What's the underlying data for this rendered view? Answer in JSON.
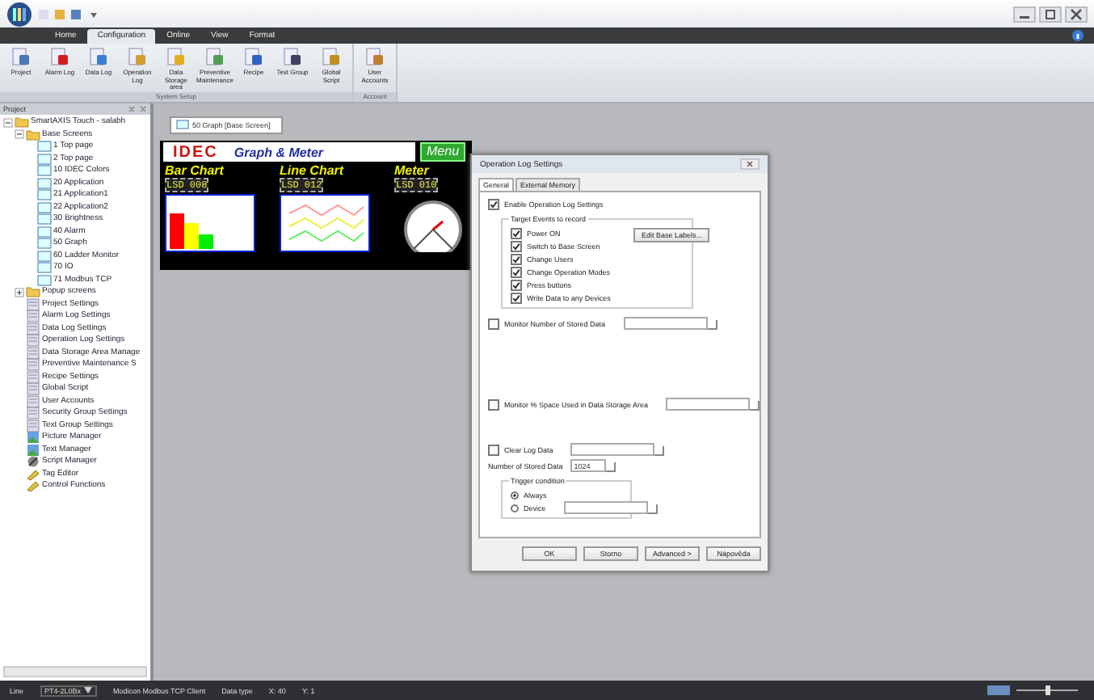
{
  "ribbon": {
    "tabs": [
      {
        "label": "Home",
        "selected": false
      },
      {
        "label": "Configuration",
        "selected": true
      },
      {
        "label": "Online",
        "selected": false
      },
      {
        "label": "View",
        "selected": false
      },
      {
        "label": "Format",
        "selected": false
      }
    ],
    "groups": [
      {
        "label": "System Setup",
        "buttons": [
          {
            "label": "Project"
          },
          {
            "label": "Alarm Log"
          },
          {
            "label": "Data Log"
          },
          {
            "label": "Operation Log"
          },
          {
            "label": "Data Storage area"
          },
          {
            "label": "Preventive Maintenance"
          },
          {
            "label": "Recipe"
          },
          {
            "label": "Text Group"
          },
          {
            "label": "Global Script"
          }
        ]
      },
      {
        "label": "Account",
        "buttons": [
          {
            "label": "User Accounts"
          }
        ]
      }
    ]
  },
  "project_panel": {
    "title": "Project",
    "tree": [
      {
        "label": "SmartAXIS Touch - salabh",
        "kind": "folder",
        "expanded": true,
        "children": [
          {
            "label": "Base Screens",
            "kind": "folder",
            "expanded": true,
            "children": [
              {
                "label": "1 Top page",
                "kind": "screen"
              },
              {
                "label": "2 Top page",
                "kind": "screen"
              },
              {
                "label": "10 IDEC Colors",
                "kind": "screen"
              },
              {
                "label": "20 Application",
                "kind": "screen"
              },
              {
                "label": "21 Application1",
                "kind": "screen"
              },
              {
                "label": "22 Application2",
                "kind": "screen"
              },
              {
                "label": "30 Brightness",
                "kind": "screen"
              },
              {
                "label": "40 Alarm",
                "kind": "screen"
              },
              {
                "label": "50 Graph",
                "kind": "screen"
              },
              {
                "label": "60 Ladder Monitor",
                "kind": "screen"
              },
              {
                "label": "70 IO",
                "kind": "screen"
              },
              {
                "label": "71 Modbus TCP",
                "kind": "screen"
              }
            ]
          },
          {
            "label": "Popup screens",
            "kind": "folder",
            "expanded": false
          },
          {
            "label": "Project Settings",
            "kind": "settings"
          },
          {
            "label": "Alarm Log Settings",
            "kind": "settings"
          },
          {
            "label": "Data Log Settings",
            "kind": "settings"
          },
          {
            "label": "Operation Log Settings",
            "kind": "settings"
          },
          {
            "label": "Data Storage Area Manage",
            "kind": "settings"
          },
          {
            "label": "Preventive Maintenance S",
            "kind": "settings"
          },
          {
            "label": "Recipe Settings",
            "kind": "settings"
          },
          {
            "label": "Global Script",
            "kind": "settings"
          },
          {
            "label": "User Accounts",
            "kind": "settings"
          },
          {
            "label": "Security Group Settings",
            "kind": "settings"
          },
          {
            "label": "Text Group Settings",
            "kind": "settings"
          },
          {
            "label": "Picture Manager",
            "kind": "picture"
          },
          {
            "label": "Text Manager",
            "kind": "picture"
          },
          {
            "label": "Script Manager",
            "kind": "script"
          },
          {
            "label": "Tag Editor",
            "kind": "tag"
          },
          {
            "label": "Control Functions",
            "kind": "tag"
          }
        ]
      }
    ]
  },
  "editor_tab": {
    "label": "50 Graph [Base Screen]"
  },
  "screen": {
    "logo": "IDEC",
    "title": "Graph & Meter",
    "menu_button": "Menu",
    "sections": [
      {
        "title": "Bar Chart",
        "kind": "bar",
        "lsd": "LSD 008"
      },
      {
        "title": "Line Chart",
        "kind": "line",
        "lsd": "LSD 012"
      },
      {
        "title": "Meter",
        "kind": "meter",
        "lsd": "LSD 010"
      }
    ]
  },
  "dialog": {
    "title": "Operation Log Settings",
    "tabs": [
      {
        "label": "General",
        "selected": true
      },
      {
        "label": "External Memory",
        "selected": false
      }
    ],
    "enable": {
      "label": "Enable Operation Log Settings",
      "checked": true
    },
    "events": {
      "title": "Target Events to record",
      "button": "Edit Base Labels...",
      "items": [
        {
          "label": "Power ON",
          "checked": true
        },
        {
          "label": "Switch to Base Screen",
          "checked": true
        },
        {
          "label": "Change Users",
          "checked": true
        },
        {
          "label": "Change Operation Modes",
          "checked": true
        },
        {
          "label": "Press buttons",
          "checked": true
        },
        {
          "label": "Write Data to any Devices",
          "checked": true
        }
      ]
    },
    "monitor_count": {
      "label": "Monitor Number of Stored Data",
      "checked": false
    },
    "monitor_space": {
      "label": "Monitor % Space Used in Data Storage Area",
      "checked": false
    },
    "clear_log": {
      "label": "Clear Log Data",
      "checked": false
    },
    "stored": {
      "label": "Number of Stored Data",
      "value": "1024"
    },
    "trigger": {
      "title": "Trigger condition",
      "options": [
        {
          "label": "Always",
          "selected": true
        },
        {
          "label": "Device",
          "selected": false
        }
      ]
    },
    "buttons": [
      "OK",
      "Storno",
      "Advanced >",
      "Nápověda"
    ]
  },
  "status_bar": [
    {
      "text": "Line",
      "kind": "label"
    },
    {
      "text": "PT4-2L0Bx",
      "kind": "dropdown"
    },
    {
      "text": "Modicon Modbus TCP Client",
      "kind": "label"
    },
    {
      "text": "Data type",
      "kind": "label"
    },
    {
      "text": "X: 40",
      "kind": "label"
    },
    {
      "text": "Y: 1",
      "kind": "label"
    }
  ]
}
